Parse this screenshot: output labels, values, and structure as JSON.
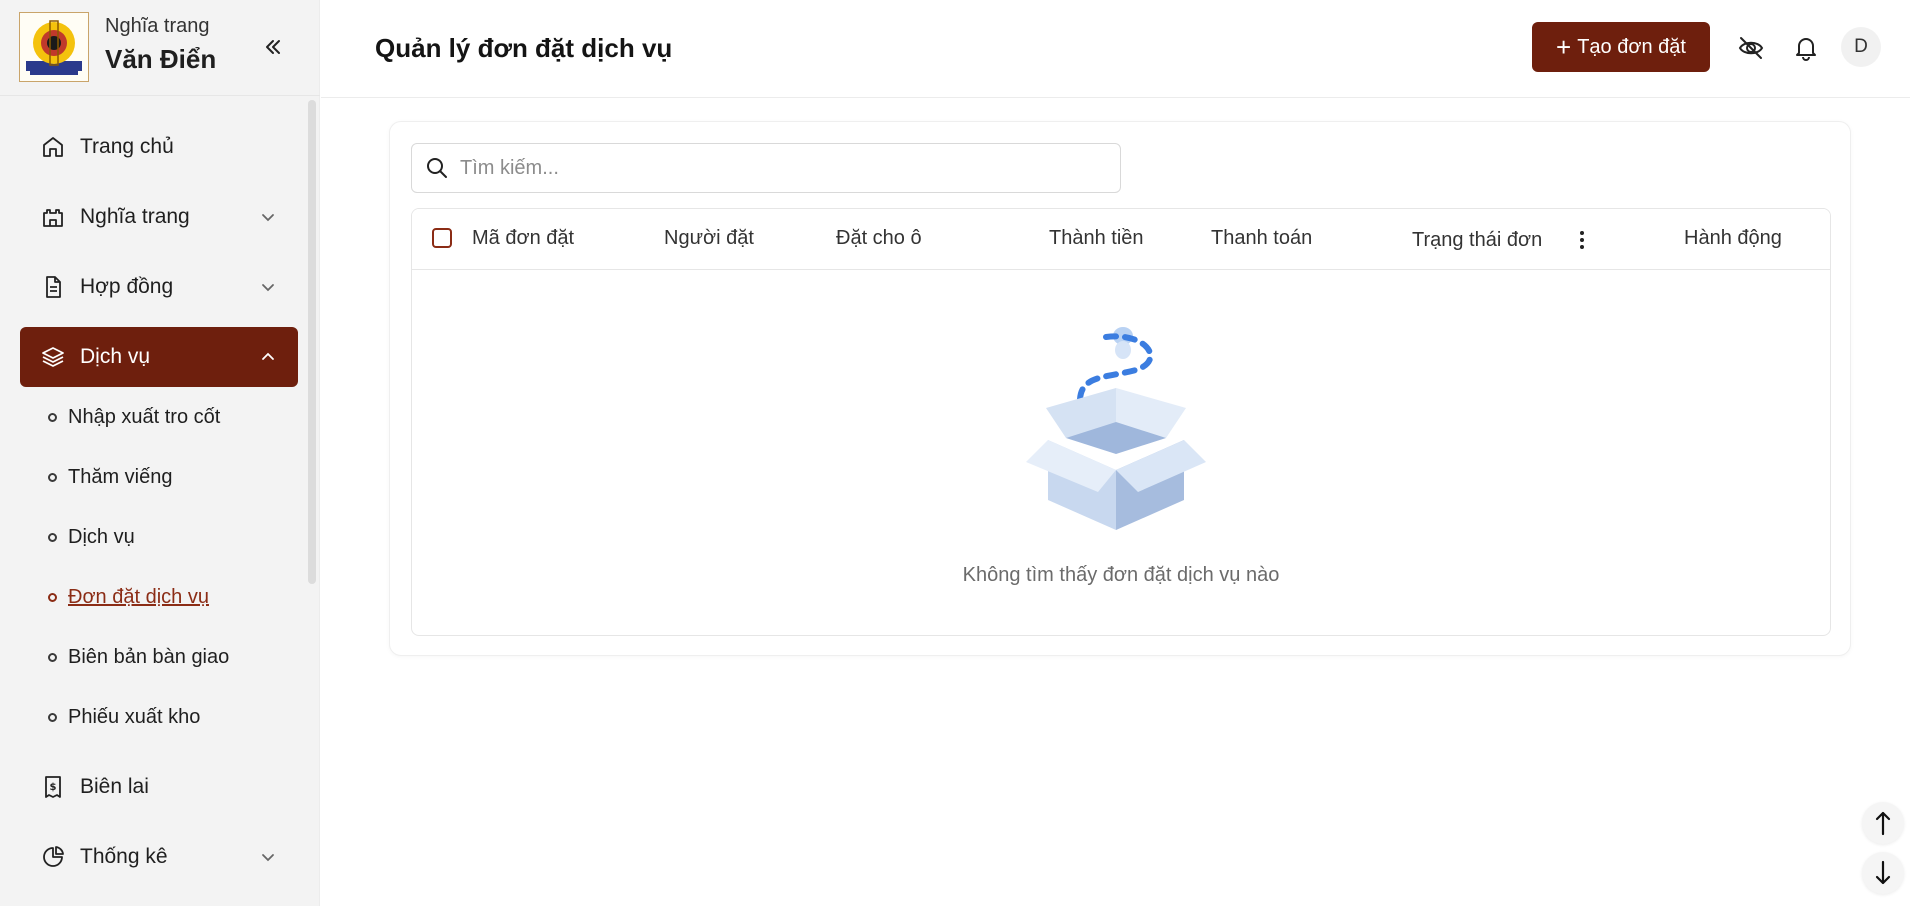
{
  "brand": {
    "line1": "Nghĩa trang",
    "line2": "Văn Điển"
  },
  "sidebar": {
    "items": [
      {
        "label": "Trang chủ",
        "icon": "home-icon"
      },
      {
        "label": "Nghĩa trang",
        "icon": "castle-icon",
        "expandable": true
      },
      {
        "label": "Hợp đồng",
        "icon": "document-icon",
        "expandable": true
      },
      {
        "label": "Dịch vụ",
        "icon": "layers-icon",
        "expandable": true,
        "active": true
      },
      {
        "label": "Biên lai",
        "icon": "receipt-icon"
      },
      {
        "label": "Thống kê",
        "icon": "pie-chart-icon",
        "expandable": true
      }
    ],
    "subitems": [
      {
        "label": "Nhập xuất tro cốt"
      },
      {
        "label": "Thăm viếng"
      },
      {
        "label": "Dịch vụ"
      },
      {
        "label": "Đơn đặt dịch vụ",
        "current": true
      },
      {
        "label": "Biên bản bàn giao"
      },
      {
        "label": "Phiếu xuất kho"
      }
    ]
  },
  "header": {
    "title": "Quản lý đơn đặt dịch vụ",
    "create_label": "Tạo đơn đặt",
    "avatar_initial": "D"
  },
  "search": {
    "placeholder": "Tìm kiếm..."
  },
  "table": {
    "columns": [
      "Mã đơn đặt",
      "Người đặt",
      "Đặt cho ô",
      "Thành tiền",
      "Thanh toán",
      "Trạng thái đơn",
      "Hành động"
    ],
    "rows": [],
    "empty_text": "Không tìm thấy đơn đặt dịch vụ nào"
  },
  "colors": {
    "accent": "#6e1f0d",
    "link": "#8b2c15",
    "sidebar_bg": "#f3f3f3"
  }
}
